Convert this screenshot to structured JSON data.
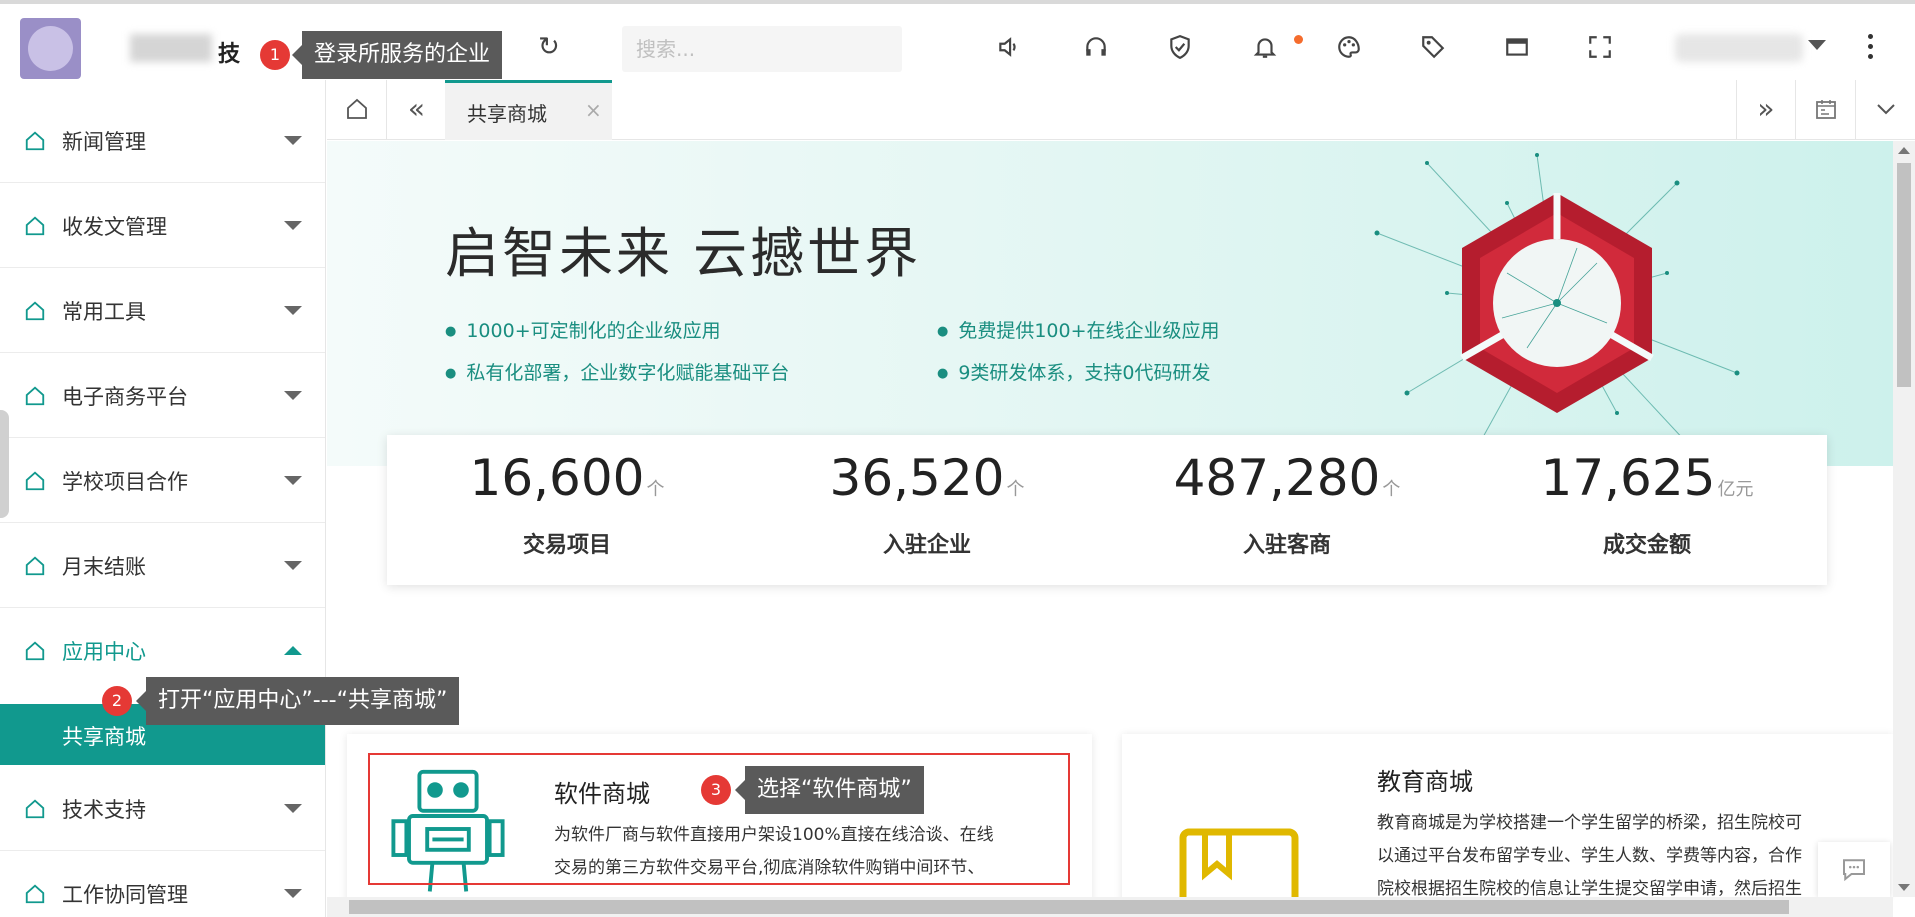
{
  "header": {
    "brand_suffix": "技",
    "search_placeholder": "搜索...",
    "icons": [
      "menu-icon",
      "globe-icon",
      "refresh-icon",
      "speaker-icon",
      "headset-icon",
      "shield-icon",
      "bell-icon",
      "palette-icon",
      "tag-icon",
      "window-icon",
      "fullscreen-icon",
      "more-icon"
    ],
    "notification_dot_color": "#f56c2d"
  },
  "annotations": [
    {
      "number": "1",
      "text": "登录所服务的企业"
    },
    {
      "number": "2",
      "text": "打开“应用中心”---“共享商城”"
    },
    {
      "number": "3",
      "text": "选择“软件商城”"
    }
  ],
  "sidebar": {
    "items": [
      {
        "label": "新闻管理"
      },
      {
        "label": "收发文管理"
      },
      {
        "label": "常用工具"
      },
      {
        "label": "电子商务平台"
      },
      {
        "label": "学校项目合作"
      },
      {
        "label": "月末结账"
      },
      {
        "label": "应用中心"
      },
      {
        "label": "技术支持"
      },
      {
        "label": "工作协同管理"
      }
    ],
    "open_item": "应用中心",
    "sub_items": [
      {
        "label": "共享商城"
      }
    ]
  },
  "tabs": {
    "active": {
      "label": "共享商城",
      "close": "×"
    }
  },
  "banner": {
    "slogan": "启智未来  云撼世界",
    "features": [
      "1000+可定制化的企业级应用",
      "免费提供100+在线企业级应用",
      "私有化部署，企业数字化赋能基础平台",
      "9类研发体系，支持0代码研发"
    ]
  },
  "stats": [
    {
      "value": "16,600",
      "unit": "个",
      "label": "交易项目"
    },
    {
      "value": "36,520",
      "unit": "个",
      "label": "入驻企业"
    },
    {
      "value": "487,280",
      "unit": "个",
      "label": "入驻客商"
    },
    {
      "value": "17,625",
      "unit": "亿元",
      "label": "成交金额"
    }
  ],
  "cards": [
    {
      "title": "软件商城",
      "desc_line1": "为软件厂商与软件直接用户架设100%直接在线洽谈、在线",
      "desc_line2": "交易的第三方软件交易平台,彻底消除软件购销中间环节、"
    },
    {
      "title": "教育商城",
      "desc_line1": "教育商城是为学校搭建一个学生留学的桥梁，招生院校可",
      "desc_line2": "以通过平台发布留学专业、学生人数、学费等内容，合作",
      "desc_line3": "院校根据招生院校的信息让学生提交留学申请，然后招生"
    }
  ],
  "colors": {
    "accent": "#11998e",
    "annotation_red": "#e53935",
    "tooltip_bg": "#5a5a5a",
    "feature_text": "#1a8e80"
  }
}
